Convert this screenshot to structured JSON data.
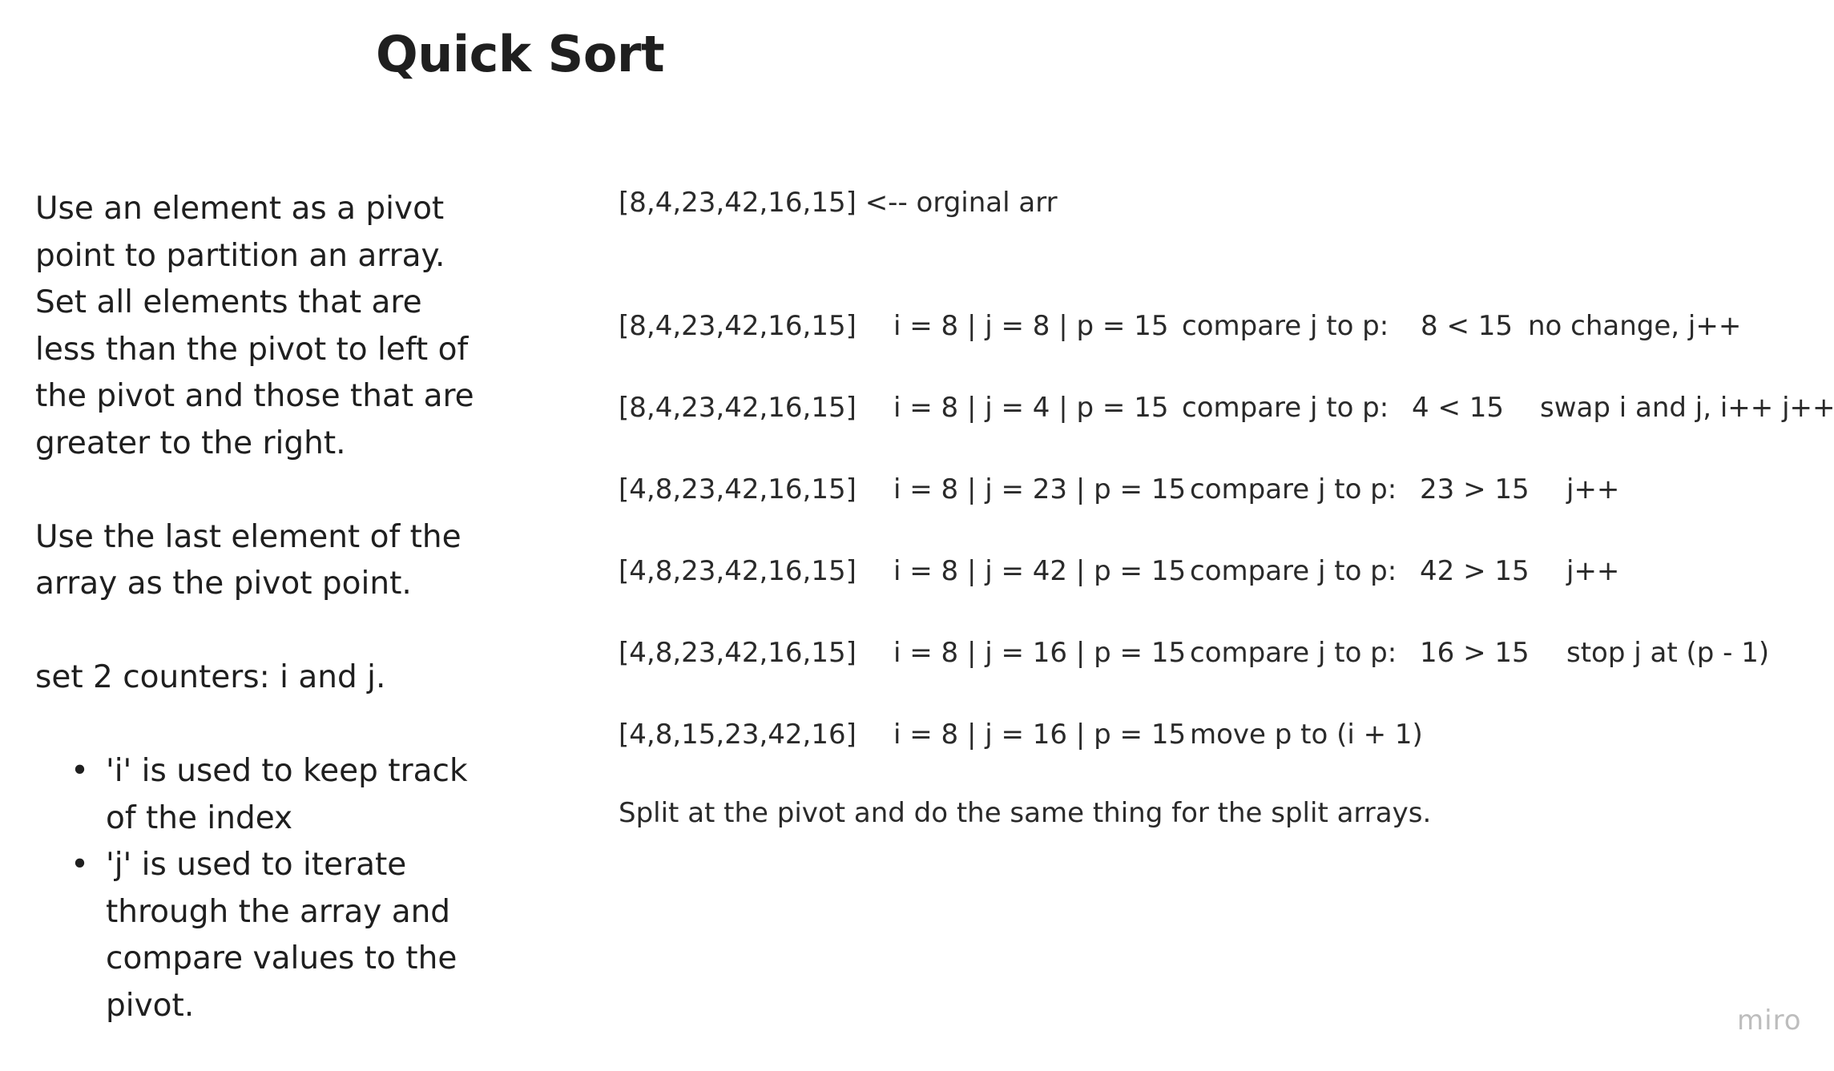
{
  "title": "Quick Sort",
  "description": {
    "para1": "Use an element as a pivot point to partition an array. Set all elements that are less than the pivot to left of the pivot and those that are greater to the right.",
    "para2": "Use the last element of the array as the pivot point.",
    "para3": "set 2 counters: i and j.",
    "bullets": [
      "'i' is used to keep track of the index",
      "'j' is used to iterate through the array and compare values to the pivot."
    ]
  },
  "original": "[8,4,23,42,16,15] <-- orginal arr",
  "steps": [
    {
      "array": "[8,4,23,42,16,15]",
      "vars": "i = 8 | j = 8 | p = 15",
      "compare": "compare  j to p:",
      "result": "8 < 15",
      "action": "no change, j++"
    },
    {
      "array": "[8,4,23,42,16,15]",
      "vars": "i = 8 | j = 4 | p = 15",
      "compare": "compare j to p:",
      "result": "4 < 15",
      "action": "swap i and j, i++ j++"
    },
    {
      "array": "[4,8,23,42,16,15]",
      "vars": "i = 8 | j = 23 | p = 15",
      "compare": "compare j to p:",
      "result": "23 > 15",
      "action": "j++"
    },
    {
      "array": "[4,8,23,42,16,15]",
      "vars": "i = 8 | j = 42 | p = 15",
      "compare": "compare j to p:",
      "result": "42 > 15",
      "action": "j++"
    },
    {
      "array": "[4,8,23,42,16,15]",
      "vars": "i = 8 | j = 16 | p = 15",
      "compare": "compare j to p:",
      "result": "16 > 15",
      "action": "stop j at (p - 1)"
    },
    {
      "array": "[4,8,15,23,42,16]",
      "vars": "i = 8 | j = 16 | p = 15",
      "compare": "move p to (i + 1)",
      "result": "",
      "action": ""
    }
  ],
  "footer_note": "Split at the pivot and do the same thing for the split arrays.",
  "logo": "miro"
}
